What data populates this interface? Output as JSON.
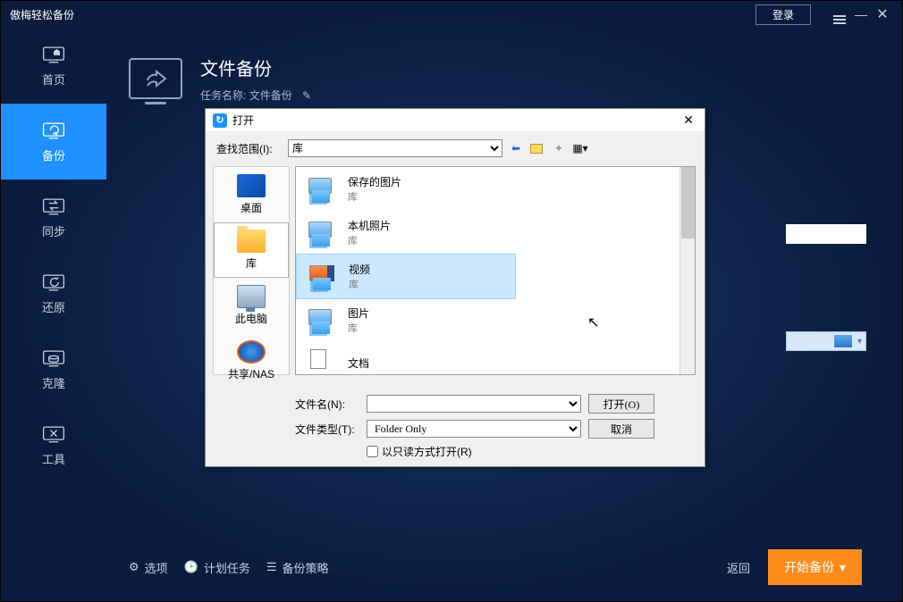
{
  "app": {
    "title": "傲梅轻松备份",
    "login": "登录"
  },
  "sidebar": {
    "items": [
      {
        "label": "首页"
      },
      {
        "label": "备份"
      },
      {
        "label": "同步"
      },
      {
        "label": "还原"
      },
      {
        "label": "克隆"
      },
      {
        "label": "工具"
      }
    ]
  },
  "page": {
    "title": "文件备份",
    "task_label": "任务名称:",
    "task_name": "文件备份"
  },
  "footer": {
    "options": "选项",
    "schedule": "计划任务",
    "strategy": "备份策略",
    "back": "返回",
    "start": "开始备份"
  },
  "dialog": {
    "title": "打开",
    "lookin_label": "查找范围(I):",
    "lookin_value": "库",
    "places": [
      {
        "label": "桌面"
      },
      {
        "label": "库"
      },
      {
        "label": "此电脑"
      },
      {
        "label": "共享/NAS"
      }
    ],
    "files": [
      {
        "name": "保存的图片",
        "type": "库"
      },
      {
        "name": "本机照片",
        "type": "库"
      },
      {
        "name": "视频",
        "type": "库"
      },
      {
        "name": "图片",
        "type": "库"
      },
      {
        "name": "文档",
        "type": ""
      }
    ],
    "filename_label": "文件名(N):",
    "filename_value": "",
    "filetype_label": "文件类型(T):",
    "filetype_value": "Folder Only",
    "readonly_label": "以只读方式打开(R)",
    "open_btn": "打开(O)",
    "cancel_btn": "取消"
  }
}
